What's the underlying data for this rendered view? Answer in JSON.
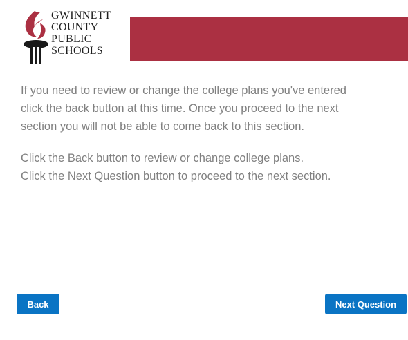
{
  "header": {
    "logo_lines": [
      "GWINNETT",
      "COUNTY",
      "PUBLIC",
      "SCHOOLS"
    ],
    "brand_color": "#ab3042"
  },
  "message": {
    "line1": "If you need to review or change  the college plans you've entered",
    "line2": "click the back button at this time.  Once you  proceed to the next",
    "line3": "section you will not be able to come back to this section.",
    "line4": "Click the Back button to review or change college plans.",
    "line5": "Click the Next Question button to proceed to the next section."
  },
  "buttons": {
    "back_label": "Back",
    "next_label": "Next Question",
    "color": "#0a74c4"
  }
}
